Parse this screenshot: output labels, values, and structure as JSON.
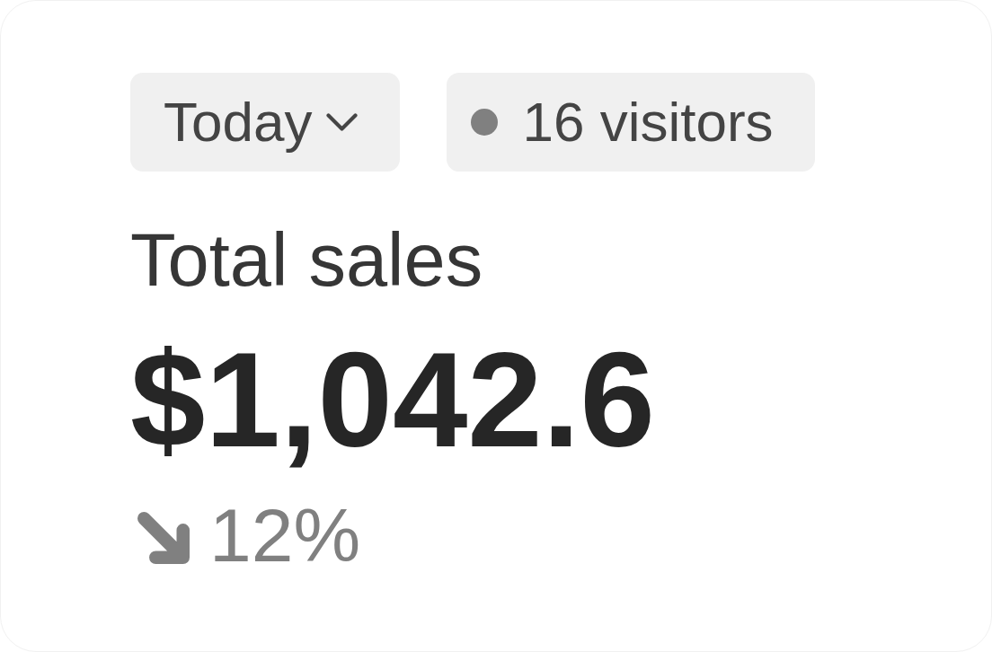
{
  "period_dropdown": {
    "label": "Today"
  },
  "visitors": {
    "label": "16 visitors"
  },
  "metric": {
    "label": "Total sales",
    "value": "$1,042.6",
    "change": {
      "decreasing": true,
      "text": "12%"
    }
  }
}
